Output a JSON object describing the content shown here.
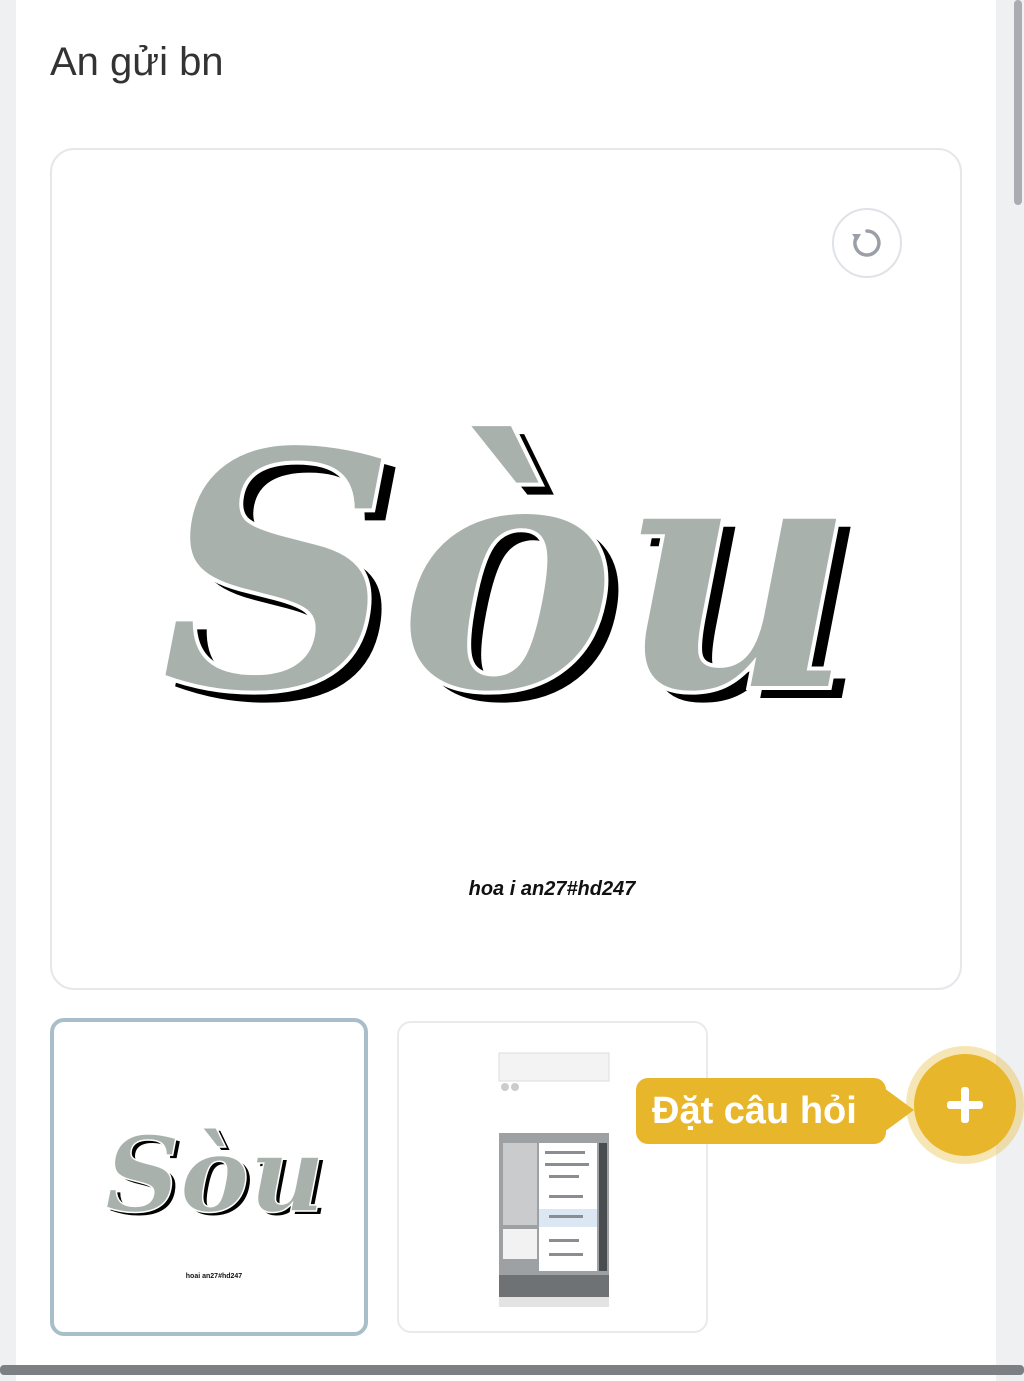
{
  "message": {
    "text": "An gửi bn"
  },
  "image_viewer": {
    "main_art_text": "Sòu",
    "signature": "hoa i an27#hd247",
    "thumbnails": [
      {
        "art_text": "Sòu",
        "signature": "hoai an27#hd247",
        "selected": true
      },
      {
        "description": "screenshot",
        "selected": false
      }
    ]
  },
  "ask_question": {
    "label": "Đặt câu hỏi",
    "icon": "plus-icon"
  },
  "colors": {
    "accent": "#e8b62a",
    "art_fill": "#a9b1ad",
    "thumb_border": "#a8bfc9"
  }
}
